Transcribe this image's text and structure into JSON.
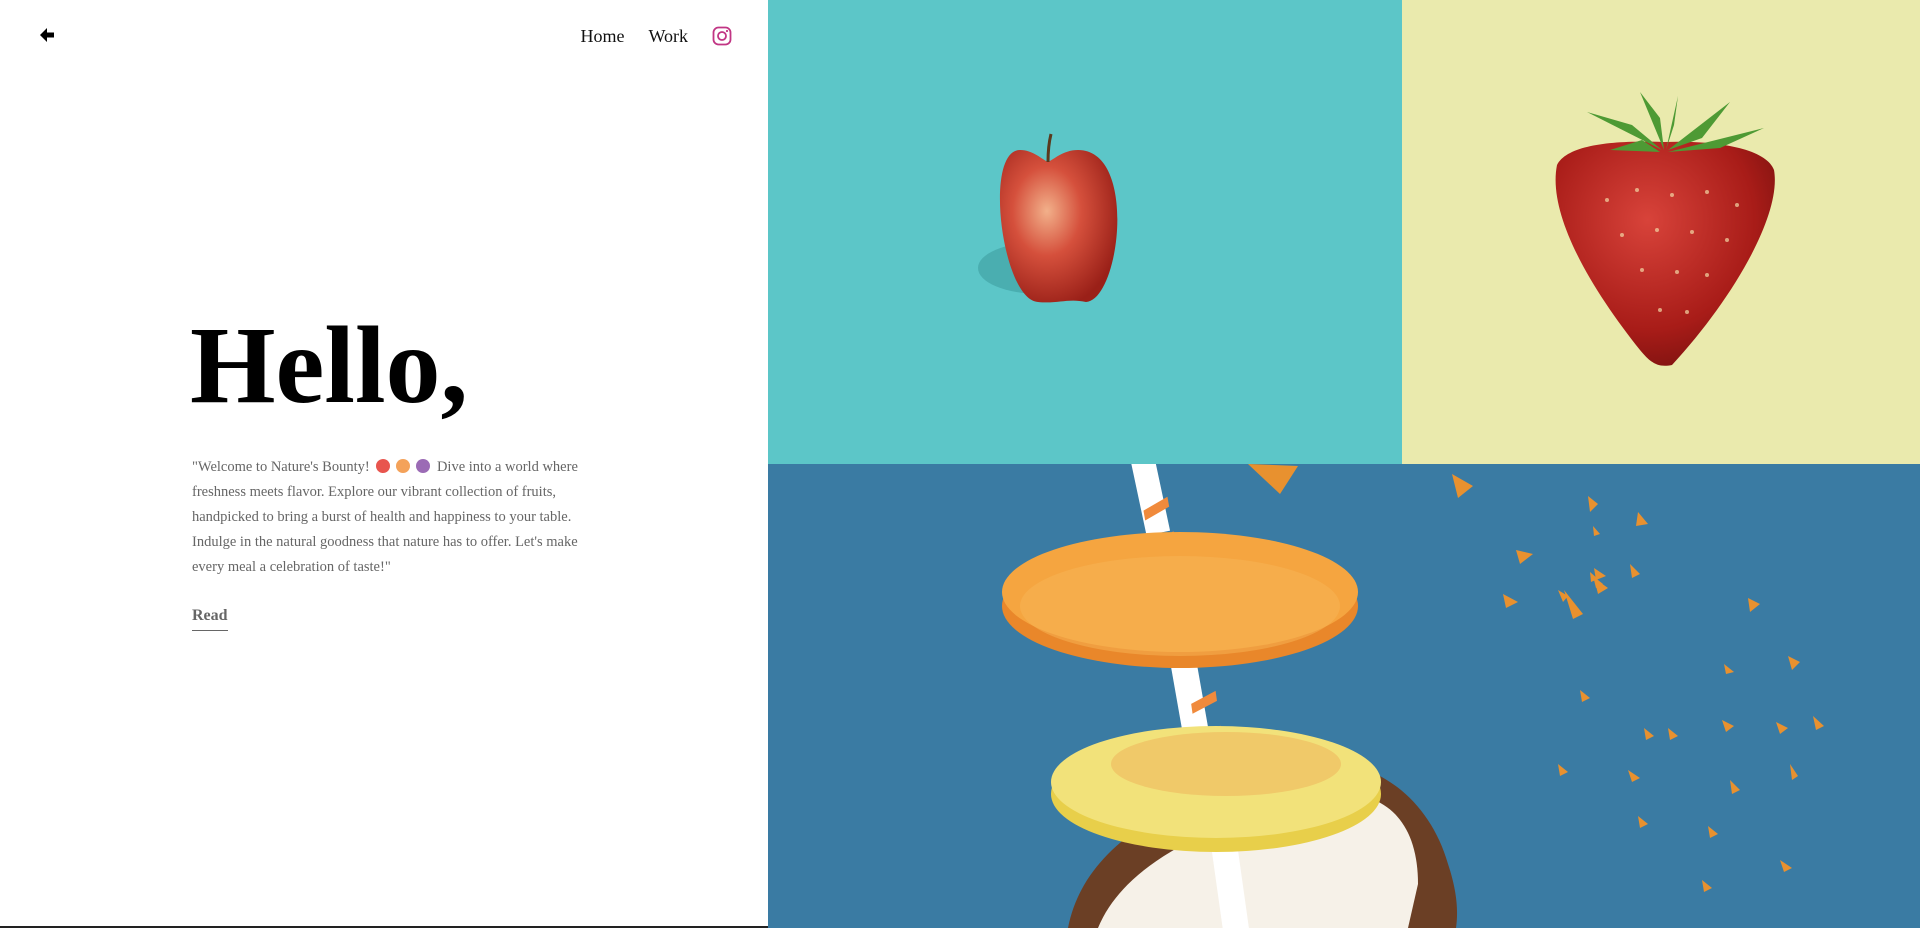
{
  "nav": {
    "back_icon": "arrow-left-icon",
    "links": [
      {
        "label": "Home"
      },
      {
        "label": "Work"
      }
    ],
    "social_icon": "instagram-icon",
    "social_color": "#c13584"
  },
  "hero": {
    "title": "Hello,",
    "description_before": "\"Welcome to Nature's Bounty!",
    "emoji_icons": [
      "apple-emoji-icon",
      "peach-emoji-icon",
      "grapes-emoji-icon"
    ],
    "description_after": "Dive into a world where freshness meets flavor. Explore our vibrant collection of fruits, handpicked to bring a burst of health and happiness to your table. Indulge in the natural goodness that nature has to offer. Let's make every meal a celebration of taste!\"",
    "read_label": "Read"
  },
  "gallery": {
    "colors": {
      "apple_bg": "#5cc6c8",
      "strawberry_bg": "#eaeaad",
      "citrus_bg": "#3a7ba3"
    },
    "images": [
      "apple-image",
      "strawberry-image",
      "citrus-slices-image"
    ]
  }
}
